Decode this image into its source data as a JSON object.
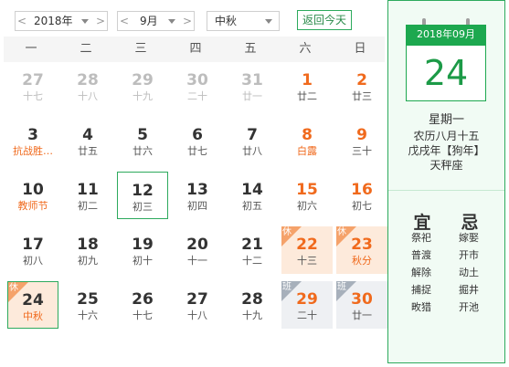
{
  "toolbar": {
    "year_label": "2018年",
    "month_label": "9月",
    "holiday_label": "中秋",
    "today_button": "返回今天",
    "prev_glyph": "<",
    "next_glyph": ">"
  },
  "weekdays": [
    "一",
    "二",
    "三",
    "四",
    "五",
    "六",
    "日"
  ],
  "weeks": [
    [
      {
        "d": "27",
        "l": "十七",
        "other": true
      },
      {
        "d": "28",
        "l": "十八",
        "other": true
      },
      {
        "d": "29",
        "l": "十九",
        "other": true
      },
      {
        "d": "30",
        "l": "二十",
        "other": true
      },
      {
        "d": "31",
        "l": "廿一",
        "other": true
      },
      {
        "d": "1",
        "l": "廿二",
        "wkend": true
      },
      {
        "d": "2",
        "l": "廿三",
        "wkend": true
      }
    ],
    [
      {
        "d": "3",
        "l": "抗战胜…",
        "fest": true
      },
      {
        "d": "4",
        "l": "廿五"
      },
      {
        "d": "5",
        "l": "廿六"
      },
      {
        "d": "6",
        "l": "廿七"
      },
      {
        "d": "7",
        "l": "廿八"
      },
      {
        "d": "8",
        "l": "白露",
        "wkend": true,
        "fest": true
      },
      {
        "d": "9",
        "l": "三十",
        "wkend": true
      }
    ],
    [
      {
        "d": "10",
        "l": "教师节",
        "fest": true
      },
      {
        "d": "11",
        "l": "初二"
      },
      {
        "d": "12",
        "l": "初三",
        "sel": true
      },
      {
        "d": "13",
        "l": "初四"
      },
      {
        "d": "14",
        "l": "初五"
      },
      {
        "d": "15",
        "l": "初六",
        "wkend": true
      },
      {
        "d": "16",
        "l": "初七",
        "wkend": true
      }
    ],
    [
      {
        "d": "17",
        "l": "初八"
      },
      {
        "d": "18",
        "l": "初九"
      },
      {
        "d": "19",
        "l": "初十"
      },
      {
        "d": "20",
        "l": "十一"
      },
      {
        "d": "21",
        "l": "十二"
      },
      {
        "d": "22",
        "l": "十三",
        "wkend": true,
        "tag": "rest"
      },
      {
        "d": "23",
        "l": "秋分",
        "wkend": true,
        "fest": true,
        "tag": "rest"
      }
    ],
    [
      {
        "d": "24",
        "l": "中秋",
        "fest": true,
        "tag": "rest",
        "today": true
      },
      {
        "d": "25",
        "l": "十六"
      },
      {
        "d": "26",
        "l": "十七"
      },
      {
        "d": "27",
        "l": "十八"
      },
      {
        "d": "28",
        "l": "十九"
      },
      {
        "d": "29",
        "l": "二十",
        "wkend": true,
        "tag": "work"
      },
      {
        "d": "30",
        "l": "廿一",
        "wkend": true,
        "tag": "work"
      }
    ]
  ],
  "tags": {
    "rest": "休",
    "work": "班"
  },
  "side": {
    "month_header": "2018年09月",
    "big_day": "24",
    "weekday": "星期一",
    "lunar": "农历八月十五",
    "ganzhi": "戊戌年【狗年】",
    "constellation": "天秤座",
    "yi_title": "宜",
    "ji_title": "忌",
    "yi_items": [
      "祭祀",
      "普渡",
      "解除",
      "捕捉",
      "畋猎"
    ],
    "ji_items": [
      "嫁娶",
      "开市",
      "动土",
      "掘井",
      "开池"
    ]
  },
  "colors": {
    "accent": "#2daa5d",
    "weekend": "#f06a1d",
    "rest_bg": "#fdeadb",
    "work_bg": "#eef0f3"
  }
}
